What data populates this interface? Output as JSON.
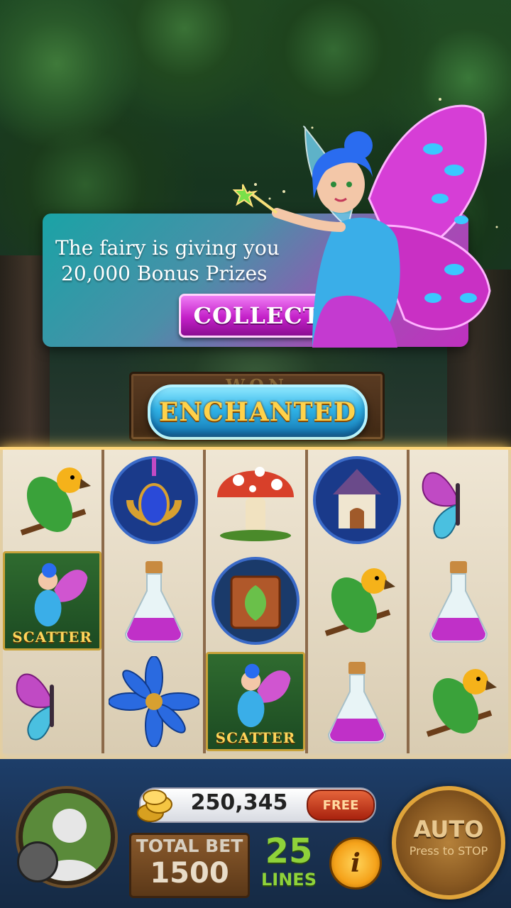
{
  "popup": {
    "line1": "The fairy is giving you",
    "line2": "20,000 Bonus Prizes",
    "collect_label": "COLLECT"
  },
  "banner": {
    "title": "ENCHANTED",
    "sign_ghost": "WON"
  },
  "reels": {
    "scatter_label": "SCATTER",
    "columns": [
      [
        "parrot",
        "fairy-scatter",
        "butterfly"
      ],
      [
        "amulet",
        "potion",
        "blue-flower"
      ],
      [
        "mushroom",
        "spell-book",
        "fairy-scatter"
      ],
      [
        "fairy-house",
        "parrot",
        "potion"
      ],
      [
        "butterfly",
        "potion",
        "parrot"
      ]
    ]
  },
  "bottom_bar": {
    "coins": "250,345",
    "free_label": "FREE",
    "total_bet_label": "TOTAL BET",
    "total_bet_value": "1500",
    "lines_value": "25",
    "lines_label": "LINES",
    "info_label": "i",
    "auto_label": "AUTO",
    "auto_sub": "Press to STOP"
  },
  "colors": {
    "popup_start": "#1aa3a6",
    "popup_end": "#c030c0",
    "collect": "#c320c8",
    "enchanted_button": "#2fb2e6",
    "gold": "#ffd24a",
    "lines_green": "#8fd23a"
  }
}
